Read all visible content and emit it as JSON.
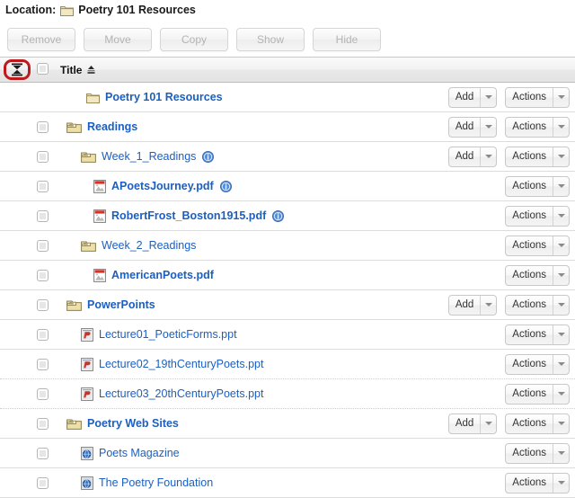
{
  "location": {
    "label": "Location:",
    "folder_icon": "folder-closed-icon",
    "name": "Poetry 101 Resources"
  },
  "toolbar": {
    "buttons": [
      {
        "label": "Remove",
        "name": "remove-button",
        "enabled": false
      },
      {
        "label": "Move",
        "name": "move-button",
        "enabled": false
      },
      {
        "label": "Copy",
        "name": "copy-button",
        "enabled": false
      },
      {
        "label": "Show",
        "name": "show-button",
        "enabled": false
      },
      {
        "label": "Hide",
        "name": "hide-button",
        "enabled": false
      }
    ]
  },
  "table": {
    "header": {
      "collapse_icon": "collapse-all-icon",
      "collapse_highlight_color": "#c0191c",
      "select_all_checkbox": false,
      "title_column": "Title",
      "sort_icon": "sort-ascending-icon"
    },
    "add_label": "Add",
    "actions_label": "Actions",
    "rows": [
      {
        "title": "Poetry 101 Resources",
        "icon": "folder-closed-icon",
        "indent": 0,
        "bold": true,
        "checkbox": false,
        "info": false,
        "add": true,
        "actions": true
      },
      {
        "title": "Readings",
        "icon": "folder-open-icon",
        "indent": 1,
        "bold": true,
        "checkbox": true,
        "info": false,
        "add": true,
        "actions": true
      },
      {
        "title": "Week_1_Readings",
        "icon": "folder-open-icon",
        "indent": 2,
        "bold": false,
        "checkbox": true,
        "info": true,
        "add": true,
        "actions": true
      },
      {
        "title": "APoetsJourney.pdf",
        "icon": "pdf-icon",
        "indent": 3,
        "bold": true,
        "checkbox": true,
        "info": true,
        "add": false,
        "actions": true
      },
      {
        "title": "RobertFrost_Boston1915.pdf",
        "icon": "pdf-icon",
        "indent": 3,
        "bold": true,
        "checkbox": true,
        "info": true,
        "add": false,
        "actions": true
      },
      {
        "title": "Week_2_Readings",
        "icon": "folder-open-icon",
        "indent": 2,
        "bold": false,
        "checkbox": true,
        "info": false,
        "add": false,
        "actions": true
      },
      {
        "title": "AmericanPoets.pdf",
        "icon": "pdf-icon",
        "indent": 3,
        "bold": true,
        "checkbox": true,
        "info": false,
        "add": false,
        "actions": true
      },
      {
        "title": "PowerPoints",
        "icon": "folder-open-icon",
        "indent": 1,
        "bold": true,
        "checkbox": true,
        "info": false,
        "add": true,
        "actions": true
      },
      {
        "title": "Lecture01_PoeticForms.ppt",
        "icon": "ppt-icon",
        "indent": 2,
        "bold": false,
        "checkbox": true,
        "info": false,
        "add": false,
        "actions": true
      },
      {
        "title": "Lecture02_19thCenturyPoets.ppt",
        "icon": "ppt-icon",
        "indent": 2,
        "bold": false,
        "checkbox": true,
        "info": false,
        "add": false,
        "actions": true
      },
      {
        "title": "Lecture03_20thCenturyPoets.ppt",
        "icon": "ppt-icon",
        "indent": 2,
        "bold": false,
        "checkbox": true,
        "info": false,
        "add": false,
        "actions": true
      },
      {
        "title": "Poetry Web Sites",
        "icon": "folder-open-icon",
        "indent": 1,
        "bold": true,
        "checkbox": true,
        "info": false,
        "add": true,
        "actions": true
      },
      {
        "title": "Poets Magazine",
        "icon": "web-link-icon",
        "indent": 2,
        "bold": false,
        "checkbox": true,
        "info": false,
        "add": false,
        "actions": true
      },
      {
        "title": "The Poetry Foundation",
        "icon": "web-link-icon",
        "indent": 2,
        "bold": false,
        "checkbox": true,
        "info": false,
        "add": false,
        "actions": true
      }
    ]
  },
  "colors": {
    "link": "#1b5fc1",
    "folder": "#e8d79a",
    "highlight": "#c0191c"
  }
}
